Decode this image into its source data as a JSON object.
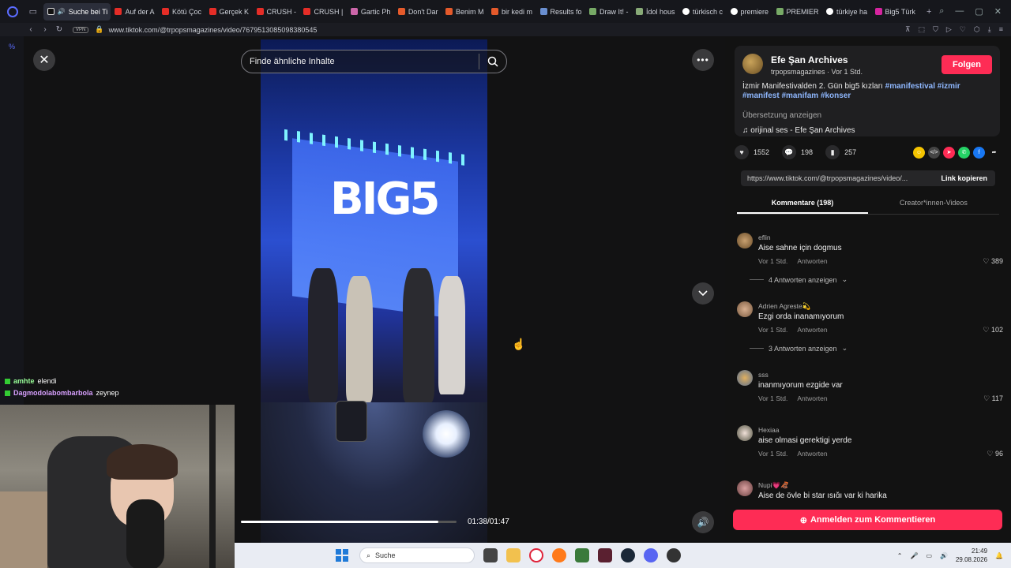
{
  "browser": {
    "tabs": [
      {
        "label": "Suche bei Ti",
        "favicon": "tiktok-favicon",
        "active": true
      },
      {
        "label": "Auf der A",
        "favicon": "youtube-favicon"
      },
      {
        "label": "Kötü Çoc",
        "favicon": "youtube-favicon"
      },
      {
        "label": "Gerçek K",
        "favicon": "youtube-favicon"
      },
      {
        "label": "CRUSH -",
        "favicon": "youtube-favicon"
      },
      {
        "label": "CRUSH |",
        "favicon": "youtube-favicon"
      },
      {
        "label": "Gartic Ph",
        "favicon": "gartic-favicon"
      },
      {
        "label": "Don't Dar",
        "favicon": "wattpad-favicon"
      },
      {
        "label": "Benim M",
        "favicon": "wattpad-favicon"
      },
      {
        "label": "bir kedi m",
        "favicon": "wattpad-favicon"
      },
      {
        "label": "Results fo",
        "favicon": "web-favicon"
      },
      {
        "label": "Draw It! -",
        "favicon": "draw-favicon"
      },
      {
        "label": "İdol hous",
        "favicon": "web-favicon"
      },
      {
        "label": "türkisch c",
        "favicon": "google-favicon"
      },
      {
        "label": "premiere",
        "favicon": "google-favicon"
      },
      {
        "label": "PREMIER",
        "favicon": "web-favicon"
      },
      {
        "label": "türkiye ha",
        "favicon": "google-favicon"
      },
      {
        "label": "Big5 Türk",
        "favicon": "instagram-favicon"
      }
    ],
    "vpn_label": "VPN",
    "url": "www.tiktok.com/@trpopsmagazines/video/7679513085098380545"
  },
  "video": {
    "search_placeholder": "Finde ähnliche Inhalte",
    "time": "01:38/01:47",
    "progress": 0.916,
    "stage_text": "BIG5"
  },
  "chat": [
    {
      "user": "amhte",
      "message": "elendi"
    },
    {
      "user": "Dagmodolabombarbola",
      "message": "zeynep"
    }
  ],
  "panel": {
    "author_name": "Efe Şan Archives",
    "author_sub": "trpopsmagazines · Vor 1 Std.",
    "follow_label": "Folgen",
    "desc_text": "İzmir Manifestivalden 2. Gün big5 kızları",
    "hashtags": [
      "#manifestival",
      "#izmir",
      "#manifest",
      "#manifam",
      "#konser"
    ],
    "translate_label": "Übersetzung anzeigen",
    "sound": "orijinal ses - Efe Şan Archives",
    "likes": "1552",
    "comments_count": "198",
    "saves": "257",
    "link": "https://www.tiktok.com/@trpopsmagazines/video/...",
    "copy_label": "Link kopieren",
    "tab_comments": "Kommentare (198)",
    "tab_creator": "Creator*innen-Videos",
    "login_label": "Anmelden zum Kommentieren"
  },
  "comments": [
    {
      "user": "eflin",
      "text": "Aise sahne için dogmus",
      "time": "Vor 1 Std.",
      "reply": "Antworten",
      "likes": "389",
      "replies": "4 Antworten anzeigen"
    },
    {
      "user": "Adrien Agreste💫",
      "text": "Ezgi orda inanamıyorum",
      "time": "Vor 1 Std.",
      "reply": "Antworten",
      "likes": "102",
      "replies": "3 Antworten anzeigen"
    },
    {
      "user": "sss",
      "text": "inanmıyorum ezgide var",
      "time": "Vor 1 Std.",
      "reply": "Antworten",
      "likes": "117"
    },
    {
      "user": "Hexiaa",
      "text": "aise olmasi gerektigi yerde",
      "time": "Vor 1 Std.",
      "reply": "Antworten",
      "likes": "96"
    },
    {
      "user": "Nupi💗🦧",
      "text": "Aise de öyle bi star ışığı var ki harika"
    }
  ],
  "taskbar": {
    "search_label": "Suche",
    "time": "21:49",
    "date": "29.08.2026"
  },
  "colors": {
    "accent": "#fe2c55",
    "hashtag": "#8fb8ff"
  }
}
